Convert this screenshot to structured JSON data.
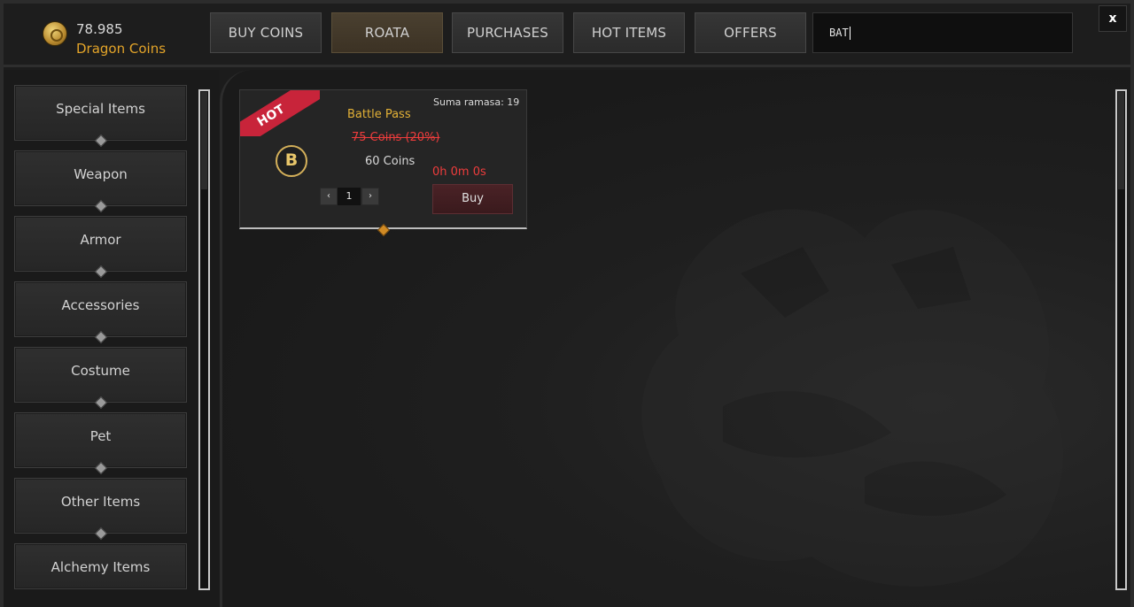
{
  "wallet": {
    "amount": "78.985",
    "currency": "Dragon Coins"
  },
  "tabs": [
    {
      "label": "BUY COINS"
    },
    {
      "label": "ROATA"
    },
    {
      "label": "PURCHASES"
    },
    {
      "label": "HOT ITEMS"
    },
    {
      "label": "OFFERS"
    }
  ],
  "active_tab": "ROATA",
  "search": {
    "value": "BAT"
  },
  "close_label": "x",
  "categories": [
    {
      "label": "Special Items"
    },
    {
      "label": "Weapon"
    },
    {
      "label": "Armor"
    },
    {
      "label": "Accessories"
    },
    {
      "label": "Costume"
    },
    {
      "label": "Pet"
    },
    {
      "label": "Other Items"
    },
    {
      "label": "Alchemy Items"
    }
  ],
  "item": {
    "badge": "HOT",
    "icon_letter": "B",
    "title": "Battle Pass",
    "count": "Suma ramasa: 19",
    "old_price": "75 Coins (20%)",
    "price": "60 Coins",
    "timer": "0h 0m 0s",
    "quantity": "1",
    "prev_symbol": "‹",
    "next_symbol": "›",
    "buy_label": "Buy"
  },
  "colors": {
    "accent_gold": "#e3a429",
    "sale_red": "#ee3c3c",
    "hot_red": "#c8243a"
  },
  "icons": [
    "dragon-coin-icon",
    "close-icon",
    "coin-b-icon",
    "chevron-left-icon",
    "chevron-right-icon"
  ]
}
